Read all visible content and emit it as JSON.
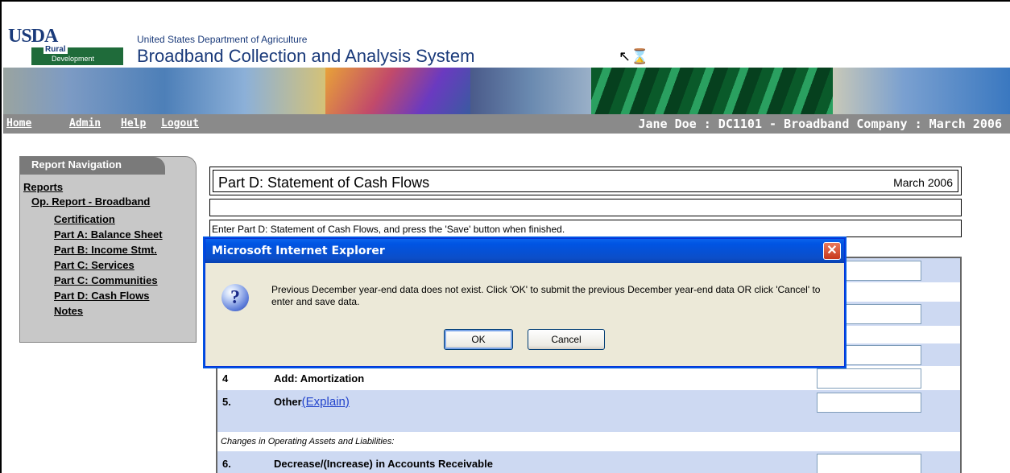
{
  "header": {
    "logo_text": "USDA",
    "rural": "Rural",
    "development": "Development",
    "agency": "United States Department of Agriculture",
    "system_name": "Broadband Collection and Analysis System"
  },
  "menu": {
    "links": [
      "Home",
      "Admin",
      "Help",
      "Logout"
    ],
    "user_info": "Jane Doe : DC1101 - Broadband Company : March 2006"
  },
  "nav": {
    "title": "Report Navigation",
    "reports": "Reports",
    "op_report": "Op. Report - Broadband",
    "items": [
      "Certification",
      "Part A: Balance Sheet",
      "Part B: Income Stmt.",
      "Part C: Services",
      "Part C: Communities",
      "Part D: Cash Flows",
      "Notes"
    ]
  },
  "content": {
    "title": "Part D: Statement of Cash Flows",
    "period": "March 2006",
    "instructions": "Enter Part D: Statement of Cash Flows, and press the 'Save' button when finished.",
    "rows": [
      {
        "num": "4",
        "label": "Add: Amortization"
      },
      {
        "num": "5.",
        "label": "Other",
        "link": "(Explain)"
      },
      {
        "num": "6.",
        "label": "Decrease/(Increase) in Accounts Receivable"
      }
    ],
    "section_label": "Changes in Operating Assets and Liabilities:"
  },
  "dialog": {
    "title": "Microsoft Internet Explorer",
    "icon": "question-icon",
    "message": "Previous December year-end data does not exist. Click 'OK' to submit the previous December year-end data OR click 'Cancel' to enter and save data.",
    "ok_label": "OK",
    "cancel_label": "Cancel",
    "close_glyph": "✕"
  },
  "colors": {
    "menubar": "#8a8a8a",
    "row_shade": "#cdd9f2",
    "dialog_title": "#0054e3"
  }
}
